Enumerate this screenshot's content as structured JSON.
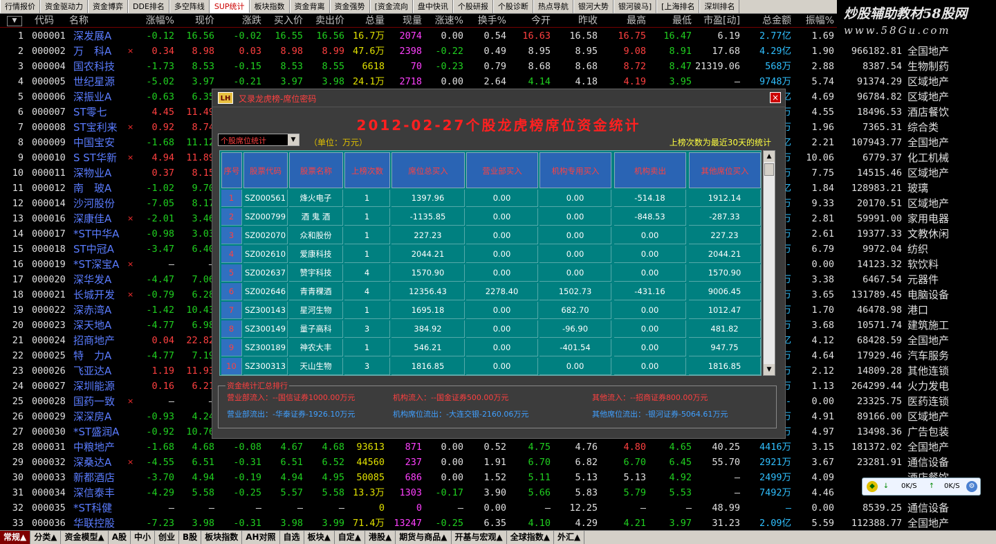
{
  "tabs": [
    "行情报价",
    "资金驱动力",
    "资金博弈",
    "DDE排名",
    "多空阵线",
    "SUP统计",
    "板块指数",
    "资金背离",
    "资金强势",
    "[资金流向",
    "盘中快讯",
    "个股研报",
    "个股诊断",
    "热点导航",
    "银河大势",
    "银河骏马]",
    "[上海排名",
    "深圳排名"
  ],
  "active_tab": "SUP统计",
  "watermark": {
    "line1": "炒股辅助教材58股网",
    "line2": "www.58Gu.com"
  },
  "columns": [
    "代码",
    "名称",
    "涨幅%",
    "现价",
    "涨跌",
    "买入价",
    "卖出价",
    "总量",
    "现量",
    "涨速%",
    "换手%",
    "今开",
    "昨收",
    "最高",
    "最低",
    "市盈[动]",
    "总金额",
    "振幅%"
  ],
  "rows": [
    {
      "no": "1",
      "code": "000001",
      "name": "深发展A",
      "x": "",
      "chg": "-0.12",
      "price": "16.56",
      "diff": "-0.02",
      "bid": "16.55",
      "ask": "16.56",
      "vol": "16.7万",
      "cur": "2074",
      "spd": "0.00",
      "turn": "0.54",
      "open": "16.63",
      "prev": "16.58",
      "high": "16.75",
      "low": "16.47",
      "pe": "6.19",
      "amt": "2.77亿",
      "amp": "1.69",
      "cap": "",
      "ind": ""
    },
    {
      "no": "2",
      "code": "000002",
      "name": "万　科A",
      "x": "×",
      "chg": "0.34",
      "price": "8.98",
      "diff": "0.03",
      "bid": "8.98",
      "ask": "8.99",
      "vol": "47.6万",
      "cur": "2398",
      "spd": "-0.22",
      "turn": "0.49",
      "open": "8.95",
      "prev": "8.95",
      "high": "9.08",
      "low": "8.91",
      "pe": "17.68",
      "amt": "4.29亿",
      "amp": "1.90",
      "cap": "966182.81",
      "ind": "全国地产"
    },
    {
      "no": "3",
      "code": "000004",
      "name": "国农科技",
      "x": "",
      "chg": "-1.73",
      "price": "8.53",
      "diff": "-0.15",
      "bid": "8.53",
      "ask": "8.55",
      "vol": "6618",
      "cur": "70",
      "spd": "-0.23",
      "turn": "0.79",
      "open": "8.68",
      "prev": "8.68",
      "high": "8.72",
      "low": "8.47",
      "pe": "21319.06",
      "amt": "568万",
      "amp": "2.88",
      "cap": "8387.54",
      "ind": "生物制药"
    },
    {
      "no": "4",
      "code": "000005",
      "name": "世纪星源",
      "x": "",
      "chg": "-5.02",
      "price": "3.97",
      "diff": "-0.21",
      "bid": "3.97",
      "ask": "3.98",
      "vol": "24.1万",
      "cur": "2718",
      "spd": "0.00",
      "turn": "2.64",
      "open": "4.14",
      "prev": "4.18",
      "high": "4.19",
      "low": "3.95",
      "pe": "—",
      "amt": "9748万",
      "amp": "5.74",
      "cap": "91374.29",
      "ind": "区域地产"
    },
    {
      "no": "5",
      "code": "000006",
      "name": "深振业A",
      "x": "",
      "chg": "-0.63",
      "price": "6.35",
      "diff": "",
      "bid": "",
      "ask": "",
      "vol": "",
      "cur": "",
      "spd": "",
      "turn": "",
      "open": "",
      "prev": "",
      "high": "",
      "low": "",
      "pe": "",
      "amt": "亿",
      "amp": "4.69",
      "cap": "96784.82",
      "ind": "区域地产"
    },
    {
      "no": "6",
      "code": "000007",
      "name": "ST零七",
      "x": "",
      "chg": "4.45",
      "price": "11.49",
      "diff": "",
      "bid": "",
      "ask": "",
      "vol": "",
      "cur": "",
      "spd": "",
      "turn": "",
      "open": "",
      "prev": "",
      "high": "",
      "low": "",
      "pe": "",
      "amt": "万",
      "amp": "4.55",
      "cap": "18496.53",
      "ind": "酒店餐饮"
    },
    {
      "no": "7",
      "code": "000008",
      "name": "ST宝利来",
      "x": "×",
      "chg": "0.92",
      "price": "8.74",
      "diff": "",
      "bid": "",
      "ask": "",
      "vol": "",
      "cur": "",
      "spd": "",
      "turn": "",
      "open": "",
      "prev": "",
      "high": "",
      "low": "",
      "pe": "",
      "amt": "万",
      "amp": "1.96",
      "cap": "7365.31",
      "ind": "综合类"
    },
    {
      "no": "8",
      "code": "000009",
      "name": "中国宝安",
      "x": "",
      "chg": "-1.68",
      "price": "11.12",
      "diff": "",
      "bid": "",
      "ask": "",
      "vol": "",
      "cur": "",
      "spd": "",
      "turn": "",
      "open": "",
      "prev": "",
      "high": "",
      "low": "",
      "pe": "",
      "amt": "亿",
      "amp": "2.21",
      "cap": "107943.77",
      "ind": "全国地产"
    },
    {
      "no": "9",
      "code": "000010",
      "name": "S ST华新",
      "x": "×",
      "chg": "4.94",
      "price": "11.89",
      "diff": "",
      "bid": "",
      "ask": "",
      "vol": "",
      "cur": "",
      "spd": "",
      "turn": "",
      "open": "",
      "prev": "",
      "high": "",
      "low": "",
      "pe": "",
      "amt": "万",
      "amp": "10.06",
      "cap": "6779.37",
      "ind": "化工机械"
    },
    {
      "no": "10",
      "code": "000011",
      "name": "深物业A",
      "x": "",
      "chg": "0.37",
      "price": "8.15",
      "diff": "",
      "bid": "",
      "ask": "",
      "vol": "",
      "cur": "",
      "spd": "",
      "turn": "",
      "open": "",
      "prev": "",
      "high": "",
      "low": "",
      "pe": "",
      "amt": "万",
      "amp": "7.75",
      "cap": "14515.46",
      "ind": "区域地产"
    },
    {
      "no": "11",
      "code": "000012",
      "name": "南　玻A",
      "x": "",
      "chg": "-1.02",
      "price": "9.70",
      "diff": "",
      "bid": "",
      "ask": "",
      "vol": "",
      "cur": "",
      "spd": "",
      "turn": "",
      "open": "",
      "prev": "",
      "high": "",
      "low": "",
      "pe": "",
      "amt": "亿",
      "amp": "1.84",
      "cap": "128983.21",
      "ind": "玻璃"
    },
    {
      "no": "12",
      "code": "000014",
      "name": "沙河股份",
      "x": "",
      "chg": "-7.05",
      "price": "8.17",
      "diff": "",
      "bid": "",
      "ask": "",
      "vol": "",
      "cur": "",
      "spd": "",
      "turn": "",
      "open": "",
      "prev": "",
      "high": "",
      "low": "",
      "pe": "",
      "amt": "万",
      "amp": "9.33",
      "cap": "20170.51",
      "ind": "区域地产"
    },
    {
      "no": "13",
      "code": "000016",
      "name": "深康佳A",
      "x": "×",
      "chg": "-2.01",
      "price": "3.46",
      "diff": "",
      "bid": "",
      "ask": "",
      "vol": "",
      "cur": "",
      "spd": "",
      "turn": "",
      "open": "",
      "prev": "",
      "high": "",
      "low": "",
      "pe": "",
      "amt": "万",
      "amp": "2.81",
      "cap": "59991.00",
      "ind": "家用电器"
    },
    {
      "no": "14",
      "code": "000017",
      "name": "*ST中华A",
      "x": "",
      "chg": "-0.98",
      "price": "3.03",
      "diff": "",
      "bid": "",
      "ask": "",
      "vol": "",
      "cur": "",
      "spd": "",
      "turn": "",
      "open": "",
      "prev": "",
      "high": "",
      "low": "",
      "pe": "",
      "amt": "万",
      "amp": "2.61",
      "cap": "19377.33",
      "ind": "文教休闲"
    },
    {
      "no": "15",
      "code": "000018",
      "name": "ST中冠A",
      "x": "",
      "chg": "-3.47",
      "price": "6.40",
      "diff": "",
      "bid": "",
      "ask": "",
      "vol": "",
      "cur": "",
      "spd": "",
      "turn": "",
      "open": "",
      "prev": "",
      "high": "",
      "low": "",
      "pe": "",
      "amt": "万",
      "amp": "6.79",
      "cap": "9972.04",
      "ind": "纺织"
    },
    {
      "no": "16",
      "code": "000019",
      "name": "*ST深宝A",
      "x": "×",
      "chg": "—",
      "price": "—",
      "diff": "",
      "bid": "",
      "ask": "",
      "vol": "",
      "cur": "",
      "spd": "",
      "turn": "",
      "open": "",
      "prev": "",
      "high": "",
      "low": "",
      "pe": "",
      "amt": "-",
      "amp": "0.00",
      "cap": "14123.32",
      "ind": "软饮料"
    },
    {
      "no": "17",
      "code": "000020",
      "name": "深华发A",
      "x": "",
      "chg": "-4.47",
      "price": "7.06",
      "diff": "",
      "bid": "",
      "ask": "",
      "vol": "",
      "cur": "",
      "spd": "",
      "turn": "",
      "open": "",
      "prev": "",
      "high": "",
      "low": "",
      "pe": "",
      "amt": "万",
      "amp": "3.38",
      "cap": "6467.54",
      "ind": "元器件"
    },
    {
      "no": "18",
      "code": "000021",
      "name": "长城开发",
      "x": "×",
      "chg": "-0.79",
      "price": "6.28",
      "diff": "",
      "bid": "",
      "ask": "",
      "vol": "",
      "cur": "",
      "spd": "",
      "turn": "",
      "open": "",
      "prev": "",
      "high": "",
      "low": "",
      "pe": "",
      "amt": "万",
      "amp": "3.65",
      "cap": "131789.45",
      "ind": "电脑设备"
    },
    {
      "no": "19",
      "code": "000022",
      "name": "深赤湾A",
      "x": "",
      "chg": "-1.42",
      "price": "10.43",
      "diff": "",
      "bid": "",
      "ask": "",
      "vol": "",
      "cur": "",
      "spd": "",
      "turn": "",
      "open": "",
      "prev": "",
      "high": "",
      "low": "",
      "pe": "",
      "amt": "万",
      "amp": "1.70",
      "cap": "46478.98",
      "ind": "港口"
    },
    {
      "no": "20",
      "code": "000023",
      "name": "深天地A",
      "x": "",
      "chg": "-4.77",
      "price": "6.98",
      "diff": "",
      "bid": "",
      "ask": "",
      "vol": "",
      "cur": "",
      "spd": "",
      "turn": "",
      "open": "",
      "prev": "",
      "high": "",
      "low": "",
      "pe": "",
      "amt": "万",
      "amp": "3.68",
      "cap": "10571.74",
      "ind": "建筑施工"
    },
    {
      "no": "21",
      "code": "000024",
      "name": "招商地产",
      "x": "",
      "chg": "0.04",
      "price": "22.82",
      "diff": "",
      "bid": "",
      "ask": "",
      "vol": "",
      "cur": "",
      "spd": "",
      "turn": "",
      "open": "",
      "prev": "",
      "high": "",
      "low": "",
      "pe": "",
      "amt": "亿",
      "amp": "4.12",
      "cap": "68428.59",
      "ind": "全国地产"
    },
    {
      "no": "22",
      "code": "000025",
      "name": "特　力A",
      "x": "",
      "chg": "-4.77",
      "price": "7.19",
      "diff": "",
      "bid": "",
      "ask": "",
      "vol": "",
      "cur": "",
      "spd": "",
      "turn": "",
      "open": "",
      "prev": "",
      "high": "",
      "low": "",
      "pe": "",
      "amt": "万",
      "amp": "4.64",
      "cap": "17929.46",
      "ind": "汽车服务"
    },
    {
      "no": "23",
      "code": "000026",
      "name": "飞亚达A",
      "x": "",
      "chg": "1.19",
      "price": "11.93",
      "diff": "",
      "bid": "",
      "ask": "",
      "vol": "",
      "cur": "",
      "spd": "",
      "turn": "",
      "open": "",
      "prev": "",
      "high": "",
      "low": "",
      "pe": "",
      "amt": "万",
      "amp": "2.12",
      "cap": "14809.28",
      "ind": "其他连锁"
    },
    {
      "no": "24",
      "code": "000027",
      "name": "深圳能源",
      "x": "",
      "chg": "0.16",
      "price": "6.21",
      "diff": "",
      "bid": "",
      "ask": "",
      "vol": "",
      "cur": "",
      "spd": "",
      "turn": "",
      "open": "",
      "prev": "",
      "high": "",
      "low": "",
      "pe": "",
      "amt": "万",
      "amp": "1.13",
      "cap": "264299.44",
      "ind": "火力发电"
    },
    {
      "no": "25",
      "code": "000028",
      "name": "国药一致",
      "x": "×",
      "chg": "—",
      "price": "—",
      "diff": "",
      "bid": "",
      "ask": "",
      "vol": "",
      "cur": "",
      "spd": "",
      "turn": "",
      "open": "",
      "prev": "",
      "high": "",
      "low": "",
      "pe": "",
      "amt": "-",
      "amp": "0.00",
      "cap": "23325.75",
      "ind": "医药连锁"
    },
    {
      "no": "26",
      "code": "000029",
      "name": "深深房A",
      "x": "",
      "chg": "-0.93",
      "price": "4.24",
      "diff": "",
      "bid": "",
      "ask": "",
      "vol": "",
      "cur": "",
      "spd": "",
      "turn": "",
      "open": "",
      "prev": "",
      "high": "",
      "low": "",
      "pe": "",
      "amt": "万",
      "amp": "4.91",
      "cap": "89166.00",
      "ind": "区域地产"
    },
    {
      "no": "27",
      "code": "000030",
      "name": "*ST盛润A",
      "x": "",
      "chg": "-0.92",
      "price": "10.76",
      "diff": "",
      "bid": "",
      "ask": "",
      "vol": "",
      "cur": "",
      "spd": "",
      "turn": "",
      "open": "",
      "prev": "",
      "high": "",
      "low": "",
      "pe": "",
      "amt": "万",
      "amp": "4.97",
      "cap": "13498.36",
      "ind": "广告包装"
    },
    {
      "no": "28",
      "code": "000031",
      "name": "中粮地产",
      "x": "",
      "chg": "-1.68",
      "price": "4.68",
      "diff": "-0.08",
      "bid": "4.67",
      "ask": "4.68",
      "vol": "93613",
      "cur": "871",
      "spd": "0.00",
      "turn": "0.52",
      "open": "4.75",
      "prev": "4.76",
      "high": "4.80",
      "low": "4.65",
      "pe": "40.25",
      "amt": "4416万",
      "amp": "3.15",
      "cap": "181372.02",
      "ind": "全国地产"
    },
    {
      "no": "29",
      "code": "000032",
      "name": "深桑达A",
      "x": "×",
      "chg": "-4.55",
      "price": "6.51",
      "diff": "-0.31",
      "bid": "6.51",
      "ask": "6.52",
      "vol": "44560",
      "cur": "237",
      "spd": "0.00",
      "turn": "1.91",
      "open": "6.70",
      "prev": "6.82",
      "high": "6.70",
      "low": "6.45",
      "pe": "55.70",
      "amt": "2921万",
      "amp": "3.67",
      "cap": "23281.91",
      "ind": "通信设备"
    },
    {
      "no": "30",
      "code": "000033",
      "name": "新都酒店",
      "x": "",
      "chg": "-3.70",
      "price": "4.94",
      "diff": "-0.19",
      "bid": "4.94",
      "ask": "4.95",
      "vol": "50085",
      "cur": "686",
      "spd": "0.00",
      "turn": "1.52",
      "open": "5.11",
      "prev": "5.13",
      "high": "5.13",
      "low": "4.92",
      "pe": "—",
      "amt": "2499万",
      "amp": "4.09",
      "cap": "",
      "ind": "酒店餐饮"
    },
    {
      "no": "31",
      "code": "000034",
      "name": "深信泰丰",
      "x": "",
      "chg": "-4.29",
      "price": "5.58",
      "diff": "-0.25",
      "bid": "5.57",
      "ask": "5.58",
      "vol": "13.3万",
      "cur": "1303",
      "spd": "-0.17",
      "turn": "3.90",
      "open": "5.66",
      "prev": "5.83",
      "high": "5.79",
      "low": "5.53",
      "pe": "—",
      "amt": "7492万",
      "amp": "4.46",
      "cap": "",
      "ind": ""
    },
    {
      "no": "32",
      "code": "000035",
      "name": "*ST科健",
      "x": "",
      "chg": "—",
      "price": "—",
      "diff": "—",
      "bid": "—",
      "ask": "—",
      "vol": "0",
      "cur": "0",
      "spd": "—",
      "turn": "0.00",
      "open": "—",
      "prev": "12.25",
      "high": "—",
      "low": "—",
      "pe": "48.99",
      "amt": "—",
      "amp": "0.00",
      "cap": "8539.25",
      "ind": "通信设备"
    },
    {
      "no": "33",
      "code": "000036",
      "name": "华联控股",
      "x": "",
      "chg": "-7.23",
      "price": "3.98",
      "diff": "-0.31",
      "bid": "3.98",
      "ask": "3.99",
      "vol": "71.4万",
      "cur": "13247",
      "spd": "-0.25",
      "turn": "6.35",
      "open": "4.10",
      "prev": "4.29",
      "high": "4.21",
      "low": "3.97",
      "pe": "31.23",
      "amt": "2.09亿",
      "amp": "5.59",
      "cap": "112388.77",
      "ind": "全国地产"
    }
  ],
  "dialog": {
    "title": "又录龙虎榜-席位密码",
    "heading": "2012-02-27个股龙虎榜席位资金统计",
    "select_value": "个股席位统计",
    "unit": "（单位：万元）",
    "note": "上榜次数为最近30天的统计",
    "columns": [
      "序号",
      "股票代码",
      "股票名称",
      "上榜次数",
      "席位总买入",
      "营业部买入",
      "机构专用买入",
      "机构卖出",
      "其他席位买入"
    ],
    "rows": [
      [
        "1",
        "SZ000561",
        "烽火电子",
        "1",
        "1397.96",
        "0.00",
        "0.00",
        "-514.18",
        "1912.14"
      ],
      [
        "2",
        "SZ000799",
        "酒 鬼 酒",
        "1",
        "-1135.85",
        "0.00",
        "0.00",
        "-848.53",
        "-287.33"
      ],
      [
        "3",
        "SZ002070",
        "众和股份",
        "1",
        "227.23",
        "0.00",
        "0.00",
        "0.00",
        "227.23"
      ],
      [
        "4",
        "SZ002610",
        "爱康科技",
        "1",
        "2044.21",
        "0.00",
        "0.00",
        "0.00",
        "2044.21"
      ],
      [
        "5",
        "SZ002637",
        "赞宇科技",
        "4",
        "1570.90",
        "0.00",
        "0.00",
        "0.00",
        "1570.90"
      ],
      [
        "6",
        "SZ002646",
        "青青稞酒",
        "4",
        "12356.43",
        "2278.40",
        "1502.73",
        "-431.16",
        "9006.45"
      ],
      [
        "7",
        "SZ300143",
        "星河生物",
        "1",
        "1695.18",
        "0.00",
        "682.70",
        "0.00",
        "1012.47"
      ],
      [
        "8",
        "SZ300149",
        "量子高科",
        "3",
        "384.92",
        "0.00",
        "-96.90",
        "0.00",
        "481.82"
      ],
      [
        "9",
        "SZ300189",
        "神农大丰",
        "1",
        "546.21",
        "0.00",
        "-401.54",
        "0.00",
        "947.75"
      ],
      [
        "10",
        "SZ300313",
        "天山生物",
        "3",
        "1816.85",
        "0.00",
        "0.00",
        "0.00",
        "1816.85"
      ]
    ],
    "summary_legend": "资金统计汇总排行",
    "summary": [
      "营业部流入：--国信证券1000.00万元",
      "机构流入：--国金证券500.00万元",
      "其他流入：--招商证券800.00万元",
      "营业部流出：-华泰证券-1926.10万元",
      "机构席位流出：-大连交银-2160.06万元",
      "其他席位流出：-银河证券-5064.61万元"
    ],
    "close_label": "×",
    "logo_label": "LH"
  },
  "bottom_tabs": [
    "常规▲",
    "分类▲",
    "资金模型▲",
    "A股",
    "中小",
    "创业",
    "B股",
    "板块指数",
    "AH对照",
    "自选",
    "板块▲",
    "自定▲",
    "港股▲",
    "期货与商品▲",
    "开基与宏观▲",
    "全球指数▲",
    "外汇▲"
  ],
  "active_bottom": "常规▲",
  "net_widget": {
    "down": "0K/S",
    "up": "0K/S"
  },
  "colors": {
    "red": "#ff4040",
    "green": "#20d020",
    "blue_name": "#5a7cff",
    "teal_table": "#008080",
    "header_blue": "#2a64b4"
  }
}
